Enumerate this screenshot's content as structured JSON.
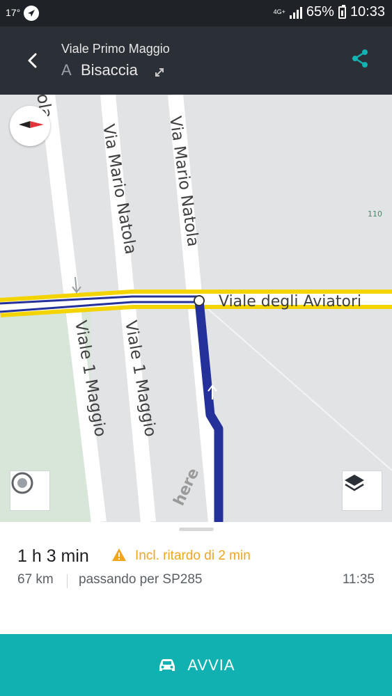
{
  "status_bar": {
    "temperature": "17°",
    "network": "4G+",
    "battery": "65%",
    "time": "10:33"
  },
  "header": {
    "from": "Viale Primo Maggio",
    "to_prefix": "A",
    "to": "Bisaccia"
  },
  "map": {
    "labels": {
      "partial_top": "ola",
      "street_1": "Via Mario Natola",
      "street_2": "Via Mario Natola",
      "street_3": "Viale degli Aviatori",
      "street_4": "Viale 1 Maggio",
      "street_5": "Viale 1 Maggio",
      "number": "110",
      "watermark": "here"
    },
    "colors": {
      "route": "#24319a",
      "highlight_road": "#f3d400",
      "park": "#d7e6d9"
    }
  },
  "route": {
    "duration": "1 h 3 min",
    "delay": "Incl. ritardo di 2 min",
    "distance": "67 km",
    "via": "passando per SP285",
    "arrival": "11:35"
  },
  "start_button": {
    "label": "AVVIA"
  }
}
